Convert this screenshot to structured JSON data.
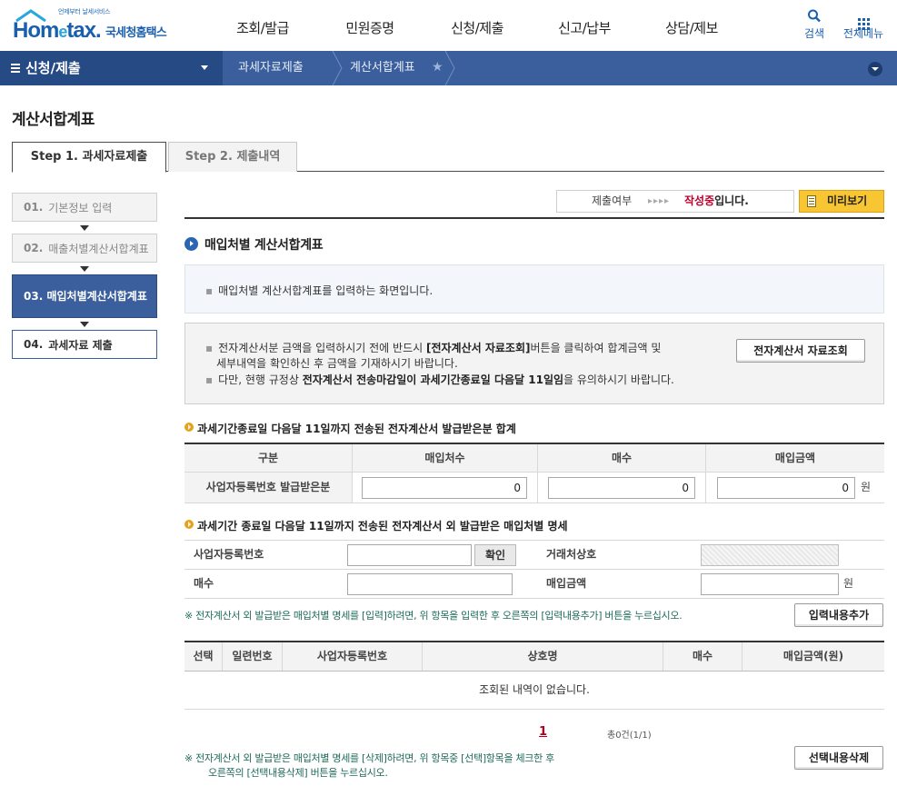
{
  "header": {
    "logo_tagline": "언제부터 날세서비스",
    "logo_home": "Hom",
    "logo_e": "e",
    "logo_tax": "tax.",
    "logo_korean": "국세청홈택스",
    "gnb": [
      "조회/발급",
      "민원증명",
      "신청/제출",
      "신고/납부",
      "상담/제보"
    ],
    "search_label": "검색",
    "menu_label": "전체메뉴"
  },
  "location": {
    "category": "신청/제출",
    "crumbs": [
      "과세자료제출",
      "계산서합계표"
    ]
  },
  "page": {
    "title": "계산서합계표"
  },
  "step_tabs": [
    "Step 1. 과세자료제출",
    "Step 2. 제출내역"
  ],
  "step_nav": [
    {
      "num": "01.",
      "label": "기본정보 입력"
    },
    {
      "num": "02.",
      "label": "매출처별계산서합계표"
    },
    {
      "num": "03.",
      "label": "매입처별계산서합계표"
    },
    {
      "num": "04.",
      "label": "과세자료 제출"
    }
  ],
  "status": {
    "label": "제출여부",
    "arrows": "▸▸▸▸",
    "value_red": "작성중",
    "value_rest": "입니다.",
    "preview_label": "미리보기"
  },
  "section": {
    "title": "매입처별 계산서합계표",
    "info1": "매입처별 계산서합계표를 입력하는 화면입니다.",
    "info2_a": "전자계산서분 금액을 입력하시기 전에 반드시 ",
    "info2_b": "[전자계산서 자료조회]",
    "info2_c": "버튼을 클릭하여 합계금액 및",
    "info2_d": "세부내역을 확인하신 후 금액을 기재하시기 바랍니다.",
    "info3_a": "다만, 현행 규정상 ",
    "info3_b": "전자계산서 전송마감일이 과세기간종료일 다음달 11일임",
    "info3_c": "을 유의하시기 바랍니다.",
    "einv_button": "전자계산서 자료조회"
  },
  "summary": {
    "title": "과세기간종료일 다음달 11일까지 전송된 전자계산서 발급받은분 합계",
    "headers": [
      "구분",
      "매입처수",
      "매수",
      "매입금액"
    ],
    "row_head": "사업자등록번호 발급받은분",
    "values": [
      "0",
      "0",
      "0"
    ],
    "unit": "원"
  },
  "detail": {
    "title": "과세기간 종료일 다음달 11일까지 전송된 전자계산서 외 발급받은 매입처별 명세",
    "bizno_label": "사업자등록번호",
    "confirm_button": "확인",
    "partner_label": "거래처상호",
    "count_label": "매수",
    "amount_label": "매입금액",
    "unit": "원",
    "note_add": "※ 전자계산서 외 발급받은 매입처별 명세를 [입력]하려면, 위 항목을 입력한 후 오른쪽의 [입력내용추가] 버튼을 누르십시오.",
    "add_button": "입력내용추가"
  },
  "list": {
    "headers": [
      "선택",
      "일련번호",
      "사업자등록번호",
      "상호명",
      "매수",
      "매입금액(원)"
    ],
    "empty": "조회된 내역이 없습니다.",
    "page": "1",
    "total": "총0건(1/1)",
    "note_del_1": "※ 전자계산서 외 발급받은 매입처별 명세를 [삭제]하려면, 위 항목중 [선택]항목을 체크한 후",
    "note_del_2": "오른쪽의 [선택내용삭제] 버튼을 누르십시오.",
    "delete_button": "선택내용삭제"
  }
}
